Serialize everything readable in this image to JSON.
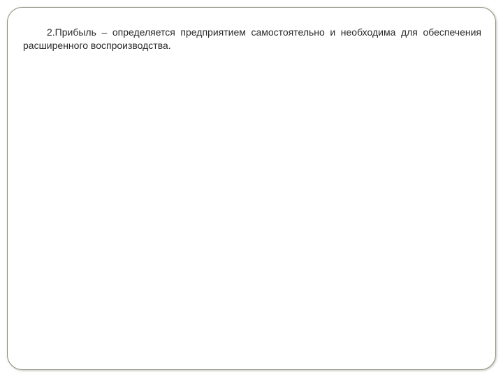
{
  "slide": {
    "paragraph": "2.Прибыль – определяется предприятием самостоятельно и необходима для обеспечения расширенного воспроизводства."
  }
}
